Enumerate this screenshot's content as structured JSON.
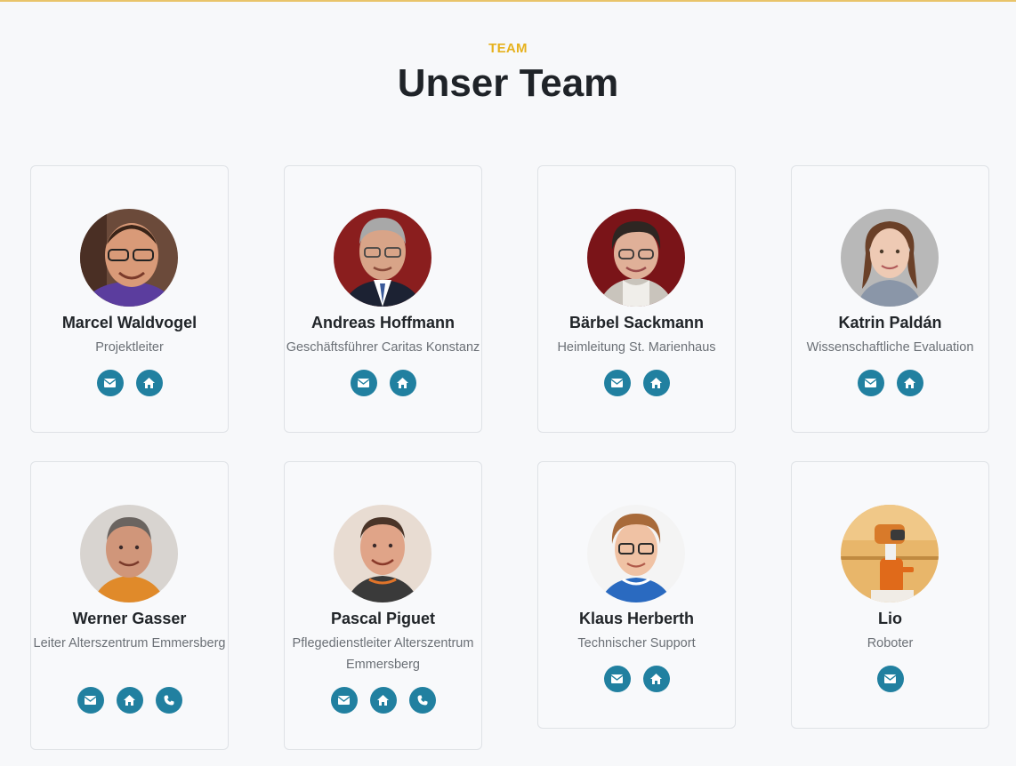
{
  "header": {
    "eyebrow": "TEAM",
    "title": "Unser Team"
  },
  "colors": {
    "accent": "#e6b11c",
    "icon_bg": "#2180a0",
    "top_border": "#e9c46a"
  },
  "members": [
    {
      "name": "Marcel Waldvogel",
      "role": "Projektleiter",
      "links": [
        "envelope-icon",
        "home-icon"
      ]
    },
    {
      "name": "Andreas Hoffmann",
      "role": "Geschäftsführer Caritas Konstanz",
      "links": [
        "envelope-icon",
        "home-icon"
      ]
    },
    {
      "name": "Bärbel Sackmann",
      "role": "Heimleitung St. Marienhaus",
      "links": [
        "envelope-icon",
        "home-icon"
      ]
    },
    {
      "name": "Katrin Paldán",
      "role": "Wissenschaftliche Evaluation",
      "links": [
        "envelope-icon",
        "home-icon"
      ]
    },
    {
      "name": "Werner Gasser",
      "role": "Leiter Alterszentrum Emmersberg",
      "links": [
        "envelope-icon",
        "home-icon",
        "phone-icon"
      ]
    },
    {
      "name": "Pascal Piguet",
      "role": "Pflegedienstleiter Alterszentrum Emmersberg",
      "links": [
        "envelope-icon",
        "home-icon",
        "phone-icon"
      ]
    },
    {
      "name": "Klaus Herberth",
      "role": "Technischer Support",
      "links": [
        "envelope-icon",
        "home-icon"
      ]
    },
    {
      "name": "Lio",
      "role": "Roboter",
      "links": [
        "envelope-icon"
      ]
    }
  ]
}
